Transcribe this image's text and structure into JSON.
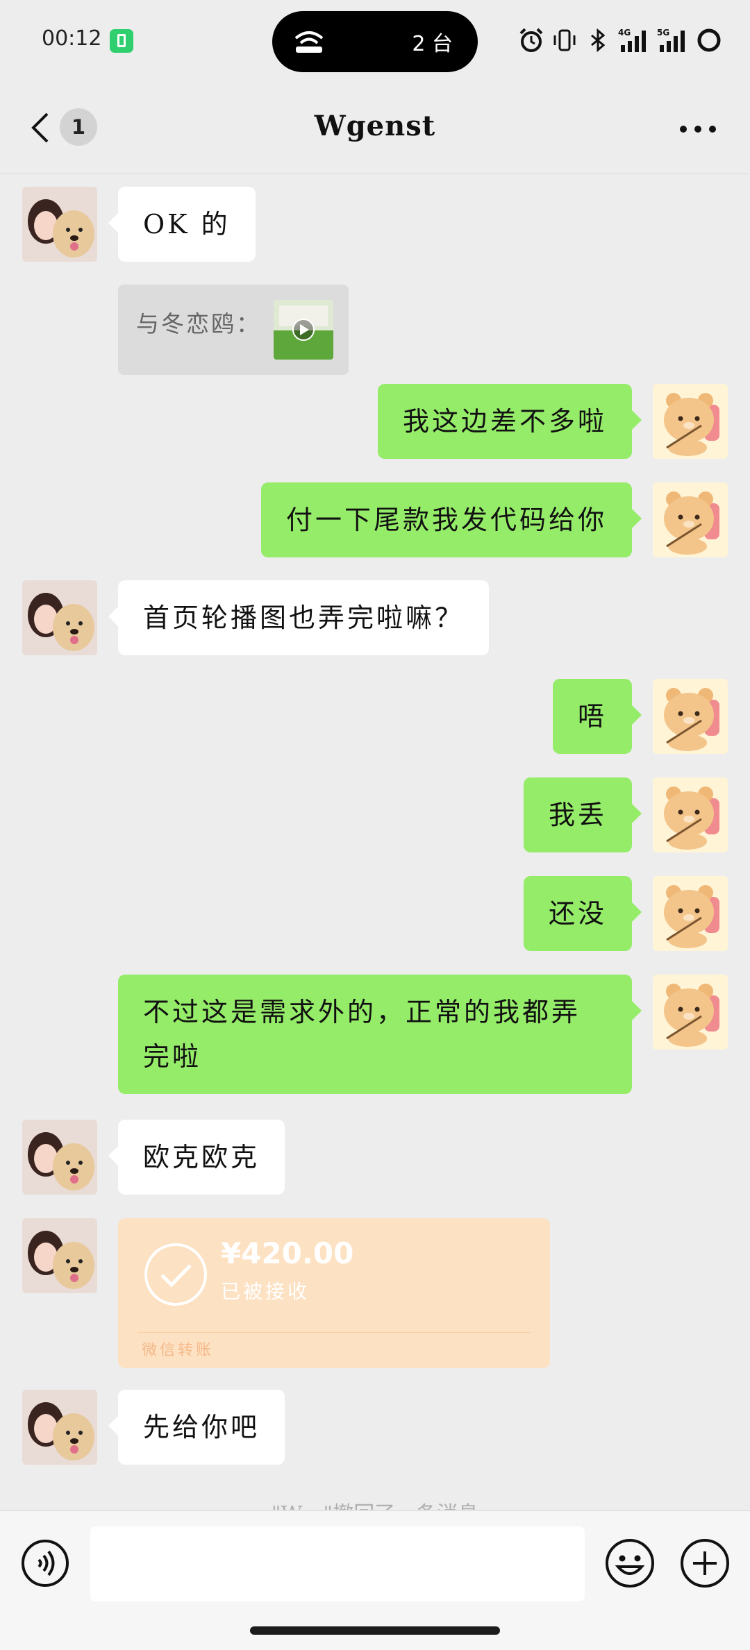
{
  "status_bar": {
    "time": "00:12",
    "pill_devices": "2 台",
    "network_4g": "4G",
    "network_5g": "5G"
  },
  "header": {
    "unread_count": "1",
    "title": "Wgenst"
  },
  "messages": [
    {
      "from": "her",
      "text": "OK 的"
    },
    {
      "from": "her",
      "type": "quote",
      "text": "与冬恋鸥："
    },
    {
      "from": "me",
      "text": "我这边差不多啦"
    },
    {
      "from": "me",
      "text": "付一下尾款我发代码给你"
    },
    {
      "from": "her",
      "text": "首页轮播图也弄完啦嘛？"
    },
    {
      "from": "me",
      "text": "唔"
    },
    {
      "from": "me",
      "text": "我丢"
    },
    {
      "from": "me",
      "text": "还没"
    },
    {
      "from": "me",
      "text": "不过这是需求外的，正常的我都弄完啦"
    },
    {
      "from": "her",
      "text": "欧克欧克"
    },
    {
      "from": "her",
      "type": "transfer",
      "amount": "¥420.00",
      "status": "已被接收",
      "source": "微信转账"
    },
    {
      "from": "her",
      "text": "先给你吧"
    }
  ],
  "recall_notice": "\"W…\"撤回了一条消息",
  "input": {
    "value": "",
    "placeholder": ""
  },
  "colors": {
    "background": "#ededed",
    "my_bubble": "#95ec69",
    "her_bubble": "#ffffff",
    "transfer_card": "#fde1c3"
  }
}
